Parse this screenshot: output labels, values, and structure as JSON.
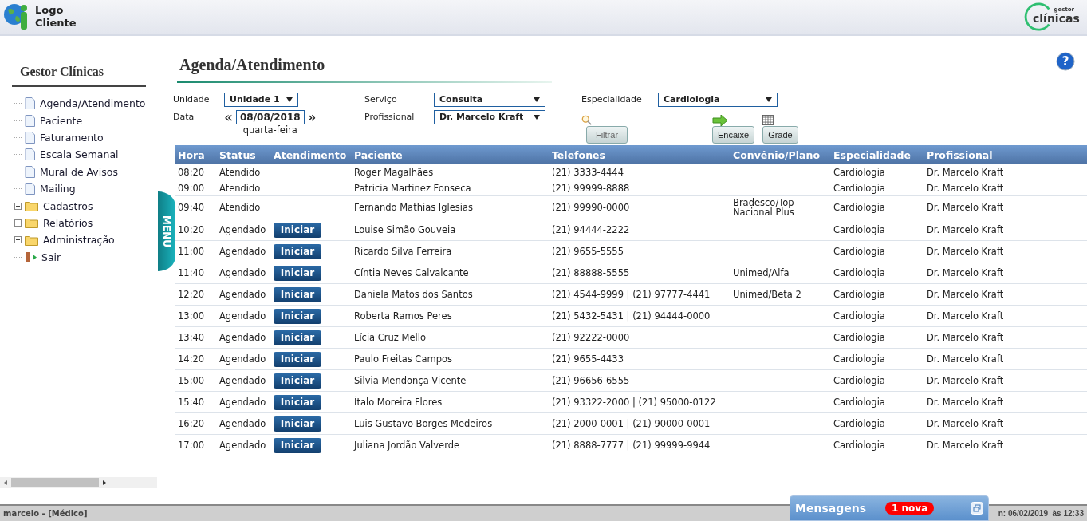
{
  "header": {
    "logo_text": "Logo Cliente",
    "brand_small": "gestor",
    "brand": "clínicas"
  },
  "sidebar": {
    "title": "Gestor Clínicas",
    "items": [
      {
        "kind": "page",
        "label": "Agenda/Atendimento"
      },
      {
        "kind": "page",
        "label": "Paciente"
      },
      {
        "kind": "page",
        "label": "Faturamento"
      },
      {
        "kind": "page",
        "label": "Escala Semanal"
      },
      {
        "kind": "page",
        "label": "Mural de Avisos"
      },
      {
        "kind": "page",
        "label": "Mailing"
      },
      {
        "kind": "folder",
        "label": "Cadastros",
        "expanded": false
      },
      {
        "kind": "folder",
        "label": "Relatórios",
        "expanded": false
      },
      {
        "kind": "folder",
        "label": "Administração",
        "expanded": false
      },
      {
        "kind": "exit",
        "label": "Sair"
      }
    ],
    "menu_tab": "MENU"
  },
  "page": {
    "title": "Agenda/Atendimento",
    "help_icon": "?"
  },
  "filters": {
    "unidade": {
      "label": "Unidade",
      "value": "Unidade 1"
    },
    "servico": {
      "label": "Serviço",
      "value": "Consulta"
    },
    "especialidade": {
      "label": "Especialidade",
      "value": "Cardiologia"
    },
    "data": {
      "label": "Data",
      "prev": "«",
      "value": "08/08/2018",
      "next": "»",
      "weekday": "quarta-feira"
    },
    "profissional": {
      "label": "Profissional",
      "value": "Dr. Marcelo Kraft"
    },
    "buttons": [
      {
        "kind": "filter",
        "label": "Filtrar"
      },
      {
        "kind": "fit",
        "label": "Encaixe"
      },
      {
        "kind": "grid",
        "label": "Grade"
      }
    ]
  },
  "table": {
    "columns": [
      "Hora",
      "Status",
      "Atendimento",
      "Paciente",
      "Telefones",
      "Convênio/Plano",
      "Especialidade",
      "Profissional"
    ],
    "rows": [
      {
        "hora": "08:20",
        "status": "Atendido",
        "paciente": "Roger Magalhães",
        "telefones": "(21) 3333-4444",
        "especialidade": "Cardiologia",
        "profissional": "Dr. Marcelo Kraft"
      },
      {
        "hora": "09:00",
        "status": "Atendido",
        "paciente": "Patricia Martinez Fonseca",
        "telefones": "(21) 99999-8888",
        "especialidade": "Cardiologia",
        "profissional": "Dr. Marcelo Kraft"
      },
      {
        "hora": "09:40",
        "status": "Atendido",
        "paciente": "Fernando Mathias Iglesias",
        "telefones": "(21) 99990-0000",
        "convenio": "Bradesco/Top Nacional Plus",
        "especialidade": "Cardiologia",
        "profissional": "Dr. Marcelo Kraft"
      },
      {
        "hora": "10:20",
        "status": "Agendado",
        "action": "Iniciar",
        "paciente": "Louise Simão Gouveia",
        "telefones": "(21) 94444-2222",
        "especialidade": "Cardiologia",
        "profissional": "Dr. Marcelo Kraft"
      },
      {
        "hora": "11:00",
        "status": "Agendado",
        "action": "Iniciar",
        "paciente": "Ricardo Silva Ferreira",
        "telefones": "(21) 9655-5555",
        "especialidade": "Cardiologia",
        "profissional": "Dr. Marcelo Kraft"
      },
      {
        "hora": "11:40",
        "status": "Agendado",
        "action": "Iniciar",
        "paciente": "Cíntia Neves Calvalcante",
        "telefones": "(21) 88888-5555",
        "convenio": "Unimed/Alfa",
        "especialidade": "Cardiologia",
        "profissional": "Dr. Marcelo Kraft"
      },
      {
        "hora": "12:20",
        "status": "Agendado",
        "action": "Iniciar",
        "paciente": "Daniela Matos dos Santos",
        "telefones": "(21) 4544-9999 | (21) 97777-4441",
        "convenio": "Unimed/Beta 2",
        "especialidade": "Cardiologia",
        "profissional": "Dr. Marcelo Kraft"
      },
      {
        "hora": "13:00",
        "status": "Agendado",
        "action": "Iniciar",
        "paciente": "Roberta Ramos Peres",
        "telefones": "(21) 5432-5431 | (21) 94444-0000",
        "especialidade": "Cardiologia",
        "profissional": "Dr. Marcelo Kraft"
      },
      {
        "hora": "13:40",
        "status": "Agendado",
        "action": "Iniciar",
        "paciente": "Lícia Cruz Mello",
        "telefones": "(21) 92222-0000",
        "especialidade": "Cardiologia",
        "profissional": "Dr. Marcelo Kraft"
      },
      {
        "hora": "14:20",
        "status": "Agendado",
        "action": "Iniciar",
        "paciente": "Paulo Freitas Campos",
        "telefones": "(21) 9655-4433",
        "especialidade": "Cardiologia",
        "profissional": "Dr. Marcelo Kraft"
      },
      {
        "hora": "15:00",
        "status": "Agendado",
        "action": "Iniciar",
        "paciente": "Silvia Mendonça Vicente",
        "telefones": "(21) 96656-6555",
        "especialidade": "Cardiologia",
        "profissional": "Dr. Marcelo Kraft"
      },
      {
        "hora": "15:40",
        "status": "Agendado",
        "action": "Iniciar",
        "paciente": "Ítalo Moreira Flores",
        "telefones": "(21) 93322-2000 | (21) 95000-0122",
        "especialidade": "Cardiologia",
        "profissional": "Dr. Marcelo Kraft"
      },
      {
        "hora": "16:20",
        "status": "Agendado",
        "action": "Iniciar",
        "paciente": "Luis Gustavo Borges Medeiros",
        "telefones": "(21) 2000-0001 | (21) 90000-0001",
        "especialidade": "Cardiologia",
        "profissional": "Dr. Marcelo Kraft"
      },
      {
        "hora": "17:00",
        "status": "Agendado",
        "action": "Iniciar",
        "paciente": "Juliana Jordão Valverde",
        "telefones": "(21) 8888-7777 | (21) 99999-9944",
        "especialidade": "Cardiologia",
        "profissional": "Dr. Marcelo Kraft"
      }
    ]
  },
  "status_bar": {
    "user": "marcelo - [Médico]",
    "session": "n: 06/02/2019  às 12:33"
  },
  "messages": {
    "title": "Mensagens",
    "badge": "1 nova"
  }
}
